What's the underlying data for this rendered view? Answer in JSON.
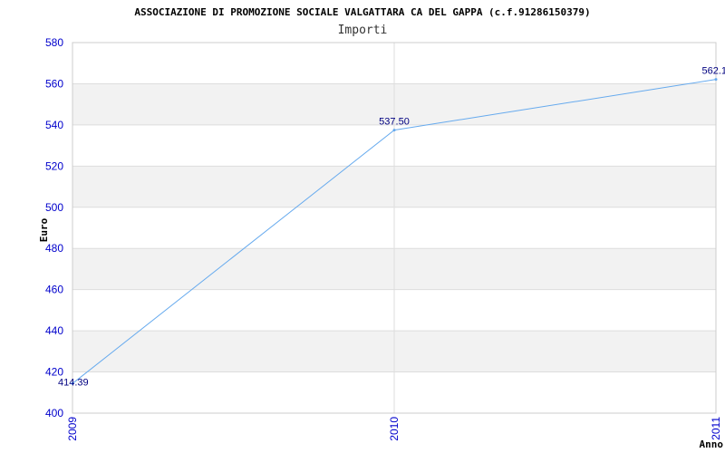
{
  "chart_data": {
    "type": "line",
    "title": "ASSOCIAZIONE DI PROMOZIONE SOCIALE VALGATTARA CA DEL GAPPA (c.f.91286150379)",
    "subtitle": "Importi",
    "xlabel": "Anno",
    "ylabel": "Euro",
    "categories": [
      "2009",
      "2010",
      "2011"
    ],
    "values": [
      414.39,
      537.5,
      562.1
    ],
    "data_labels": [
      "414.39",
      "537.50",
      "562.1"
    ],
    "ylim": [
      400,
      580
    ],
    "yticks": [
      "400",
      "420",
      "440",
      "460",
      "480",
      "500",
      "520",
      "540",
      "560",
      "580"
    ],
    "grid": true,
    "colors": {
      "line": "#66aaee",
      "band": "#f2f2f2",
      "tick": "#0000cc",
      "label": "#000080"
    }
  }
}
